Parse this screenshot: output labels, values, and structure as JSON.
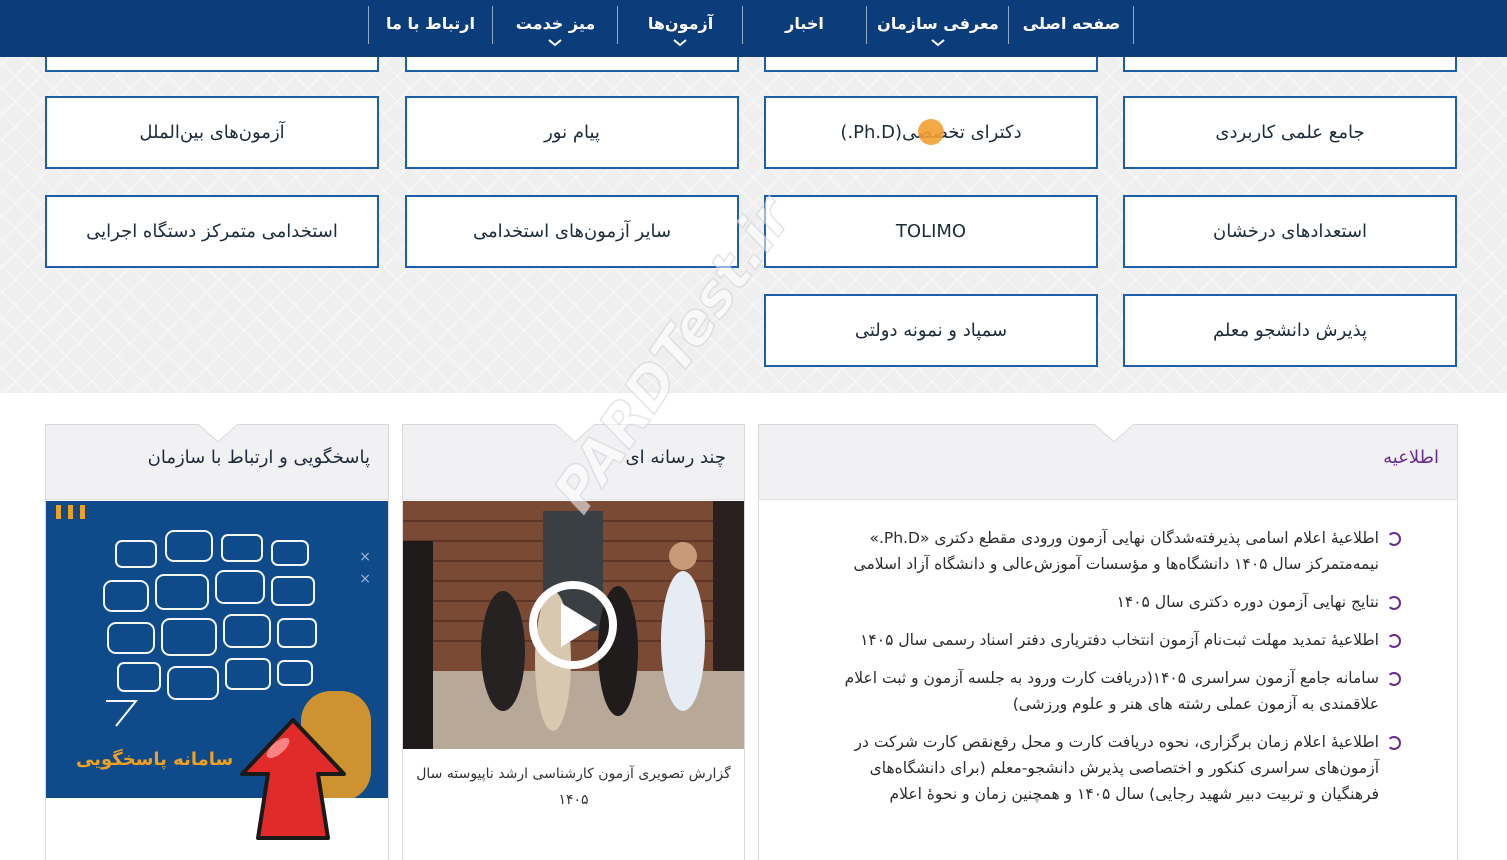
{
  "nav": {
    "items": [
      {
        "label": "صفحه اصلی",
        "has_submenu": false
      },
      {
        "label": "معرفی سازمان",
        "has_submenu": true
      },
      {
        "label": "اخبار",
        "has_submenu": false
      },
      {
        "label": "آزمون‌ها",
        "has_submenu": true
      },
      {
        "label": "میز خدمت",
        "has_submenu": true
      },
      {
        "label": "ارتباط با ما",
        "has_submenu": false
      }
    ]
  },
  "exams": {
    "row1": [
      "جامع علمی کاربردی",
      "دکترای تخصصی(Ph.D.)",
      "پیام نور",
      "آزمون‌های بین‌الملل"
    ],
    "row2": [
      "استعدادهای درخشان",
      "TOLIMO",
      "سایر آزمون‌های استخدامی",
      "استخدامی متمرکز دستگاه اجرایی"
    ],
    "row3": [
      "پذیرش دانشجو معلم",
      "سمپاد و نمونه دولتی"
    ]
  },
  "announcements": {
    "title": "اطلاعیه",
    "items": [
      "اطلاعیهٔ اعلام اسامی پذیرفته‌شدگان نهایی آزمون ورودی مقطع دکتری «Ph.D.» نیمه‌متمرکز سال ۱۴۰۵ دانشگاه‌ها و مؤسسات آموزش‌عالی و دانشگاه آزاد اسلامی",
      "نتایج نهایی آزمون دوره دکتری سال ۱۴۰۵",
      "اطلاعیهٔ تمدید مهلت ثبت‌نام آزمون  انتخاب دفتریاری دفتر اسناد رسمی سال ۱۴۰۵",
      "سامانه جامع آزمون سراسری ۱۴۰۵(دریافت کارت ورود به جلسه آزمون و ثبت اعلام علاقمندی به آزمون عملی رشته های هنر و علوم ورزشی)",
      "اطلاعیهٔ اعلام زمان برگزاری، نحوه دریافت کارت و محل رفع‌نقص کارت شرکت در آزمون‌های سراسری کنکور و اختصاصی پذیرش دانشجو-معلم (برای دانشگاه‌های فرهنگیان و تربیت دبیر شهید رجایی) سال ۱۴۰۵ و همچنین زمان و نحوهٔ اعلام"
    ]
  },
  "multimedia": {
    "title": "چند رسانه ای",
    "caption": "گزارش تصویری آزمون کارشناسی ارشد ناپیوسته سال ۱۴۰۵"
  },
  "support": {
    "title": "پاسخگویی و ارتباط با سازمان",
    "banner_text": "سامانه پاسخگویی"
  },
  "watermark": "PARDTest.ir",
  "colors": {
    "nav_bg": "#0b3d7a",
    "button_border": "#1c5fa8",
    "accent_purple": "#6a2c91",
    "banner_orange": "#f0a020"
  }
}
